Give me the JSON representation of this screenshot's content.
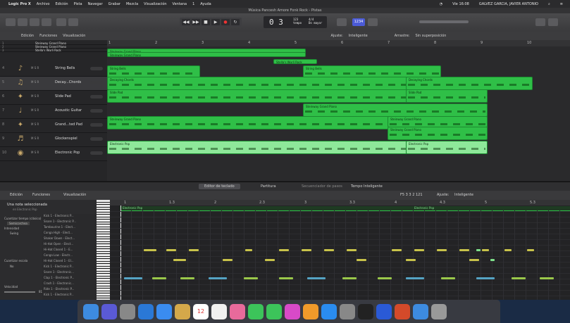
{
  "menubar": {
    "apple": "",
    "items": [
      "Logic Pro X",
      "Archivo",
      "Edición",
      "Pista",
      "Navegar",
      "Grabar",
      "Mezcla",
      "Visualización",
      "Ventana",
      "1",
      "Ayuda"
    ],
    "clock": "Vie 16:08",
    "user": "GALVEZ GARCIA, JAVIER ANTONIO"
  },
  "window_title": "Música Pancesh Amore Fonk Rock - Pistas",
  "lcd": {
    "position": "0 3",
    "tempo": "123",
    "signature": "4/4",
    "key": "Do mayor",
    "label_tempo": "tempo",
    "label_sig": "compás"
  },
  "control_badge": "1234",
  "track_toolbar": {
    "edit": "Edición",
    "functions": "Funciones",
    "view": "Visualización",
    "snap_label": "Ajuste:",
    "snap_value": "Inteligente",
    "drag_label": "Arrastre:",
    "drag_value": "Sin superposición"
  },
  "ruler_bars": [
    "1",
    "2",
    "3",
    "4",
    "5",
    "6",
    "7",
    "8",
    "9",
    "10"
  ],
  "tracks": [
    {
      "num": "1",
      "name": "Steinway Grand Piano",
      "icon": "piano-icon",
      "color": "#2fbf47"
    },
    {
      "num": "2",
      "name": "Steinway Grand Piano",
      "icon": "piano-icon",
      "color": "#2fbf47"
    },
    {
      "num": "3",
      "name": "Stella's Wurli Rock",
      "icon": "piano-icon",
      "color": "#2fbf47"
    },
    {
      "num": "4",
      "name": "String Bells",
      "icon": "bells-icon",
      "color": "#2fbf47"
    },
    {
      "num": "5",
      "name": "Decay...Chords",
      "icon": "synth-icon",
      "color": "#2fbf47"
    },
    {
      "num": "6",
      "name": "Slide Pad",
      "icon": "pad-icon",
      "color": "#2fbf47"
    },
    {
      "num": "7",
      "name": "Acoustic Guitar",
      "icon": "guitar-icon",
      "color": "#2fbf47"
    },
    {
      "num": "8",
      "name": "Grand...ted Pad",
      "icon": "pad-icon",
      "color": "#2fbf47"
    },
    {
      "num": "9",
      "name": "Glockenspiel",
      "icon": "glock-icon",
      "color": "#2fbf47"
    },
    {
      "num": "10",
      "name": "Electronic Pop",
      "icon": "drums-icon",
      "color": "#2fbf47"
    }
  ],
  "regions": [
    {
      "label": "Steinway Grand Piano"
    },
    {
      "label": "Steinway Grand Piano"
    },
    {
      "label": "Stella's Wurli Rock"
    },
    {
      "label": "String Bells"
    },
    {
      "label": "String Bells"
    },
    {
      "label": "Decaying Chords"
    },
    {
      "label": "Decaying Chords"
    },
    {
      "label": "Slide Pad"
    },
    {
      "label": "Slide Pad"
    },
    {
      "label": "Steinway Grand Piano"
    },
    {
      "label": "Steinway Grand Piano"
    },
    {
      "label": "Steinway Grand Piano"
    },
    {
      "label": "Steinway Grand Piano"
    },
    {
      "label": "Electronic Pop"
    },
    {
      "label": "Electronic Pop"
    }
  ],
  "editor_tabs": [
    "Editor de teclado",
    "Partitura",
    "Secuenciador de pasos",
    "Tempo Inteligente"
  ],
  "editor_bar": {
    "edit": "Edición",
    "functions": "Funciones",
    "view": "Visualización",
    "position": "F5 3 3 2 121",
    "snap_label": "Ajuste:",
    "snap_value": "Inteligente"
  },
  "inspector": {
    "selection": "Una nota seleccionada",
    "sub": "en Electronic Pop",
    "quantize_label": "Cuantizar tiempo (clásico)",
    "quantize_value": "Semicorchea",
    "intensity_label": "Intensidad",
    "intensity_value": "100",
    "swing_label": "Swing",
    "swing_value": "0",
    "scale_label": "Cuantizar escala",
    "scale_value": "No",
    "velocity_label": "Velocidad",
    "velocity_value": "81"
  },
  "roll_ruler": [
    "1",
    "1.3",
    "2",
    "2.3",
    "3",
    "3.3",
    "4",
    "4.3",
    "5",
    "5.3"
  ],
  "roll_region_labels": [
    "Electronic Pop",
    "Electronic Pop"
  ],
  "drum_lanes": [
    "Kick 1 - Electronic P...",
    "Snare 1 - Electronic P...",
    "Tambourine 1 - Elect...",
    "Conga High - Elect...",
    "Shaker Down - Elect...",
    "Hi-Hat Open - Elect...",
    "Hi-Hat Closed 1 - E...",
    "Conga Low - Electr...",
    "Hi-Hat Closed 1 - El...",
    "Kick 1 - Electronic P...",
    "Snare 1 - Electronic...",
    "Clap 1 - Electronic P...",
    "Crash 1 - Electronic...",
    "Ride 1 - Electronic P...",
    "Kick 1 - Electronic P..."
  ],
  "dock_apps": [
    "finder-icon",
    "siri-icon",
    "launchpad-icon",
    "safari-icon",
    "mail-icon",
    "notes-icon",
    "calendar-icon",
    "reminders-icon",
    "photos-icon",
    "messages-icon",
    "facetime-icon",
    "itunes-icon",
    "ibooks-icon",
    "appstore-icon",
    "prefs-icon",
    "logic-icon",
    "word-icon",
    "powerpoint-icon",
    "finder2-icon",
    "trash-icon"
  ],
  "calendar_day": "12"
}
